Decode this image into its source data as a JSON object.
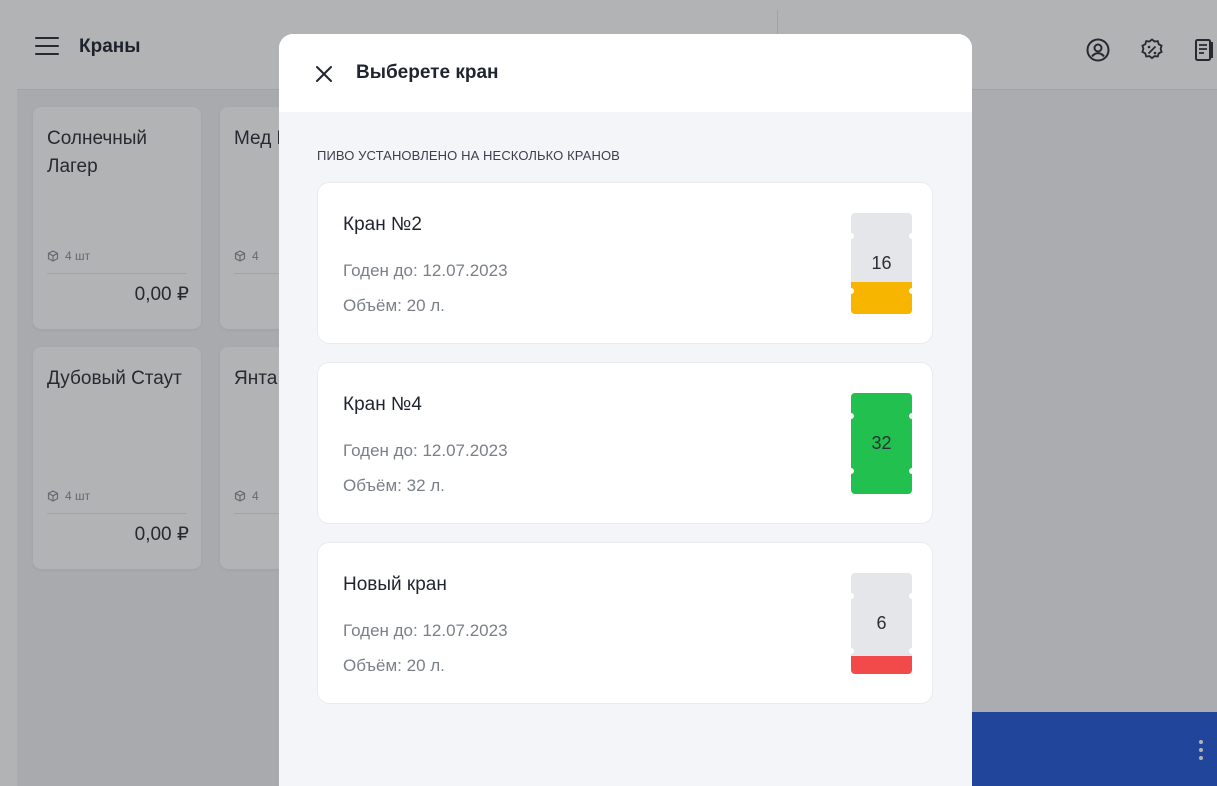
{
  "app": {
    "title": "Краны"
  },
  "header": {
    "icons": [
      "user-circle-icon",
      "discount-icon",
      "receipt-icon"
    ]
  },
  "products": [
    {
      "name": "Солнечный Лагер",
      "qty": "4 шт",
      "price": "0,00 ₽"
    },
    {
      "name": "Мед Порт",
      "qty": "4",
      "price": ""
    },
    {
      "name": "Дубовый Стаут",
      "qty": "4 шт",
      "price": "0,00 ₽"
    },
    {
      "name": "Янта Лаге",
      "qty": "4",
      "price": ""
    }
  ],
  "modal": {
    "title": "Выберете кран",
    "subtitle": "ПИВО УСТАНОВЛЕНО НА НЕСКОЛЬКО КРАНОВ",
    "taps": [
      {
        "name": "Кран №2",
        "expiry": "Годен до: 12.07.2023",
        "volume": "Объём: 20 л.",
        "remaining": "16",
        "fill_fraction": 0.32,
        "color": "#f7b500"
      },
      {
        "name": "Кран №4",
        "expiry": "Годен до: 12.07.2023",
        "volume": "Объём: 32 л.",
        "remaining": "32",
        "fill_fraction": 1.0,
        "color": "#22c14f"
      },
      {
        "name": "Новый кран",
        "expiry": "Годен до: 12.07.2023",
        "volume": "Объём: 20 л.",
        "remaining": "6",
        "fill_fraction": 0.18,
        "color": "#f24a4a"
      }
    ]
  },
  "colors": {
    "accent": "#2358d8",
    "overlay": "rgba(30,32,38,0.34)"
  }
}
